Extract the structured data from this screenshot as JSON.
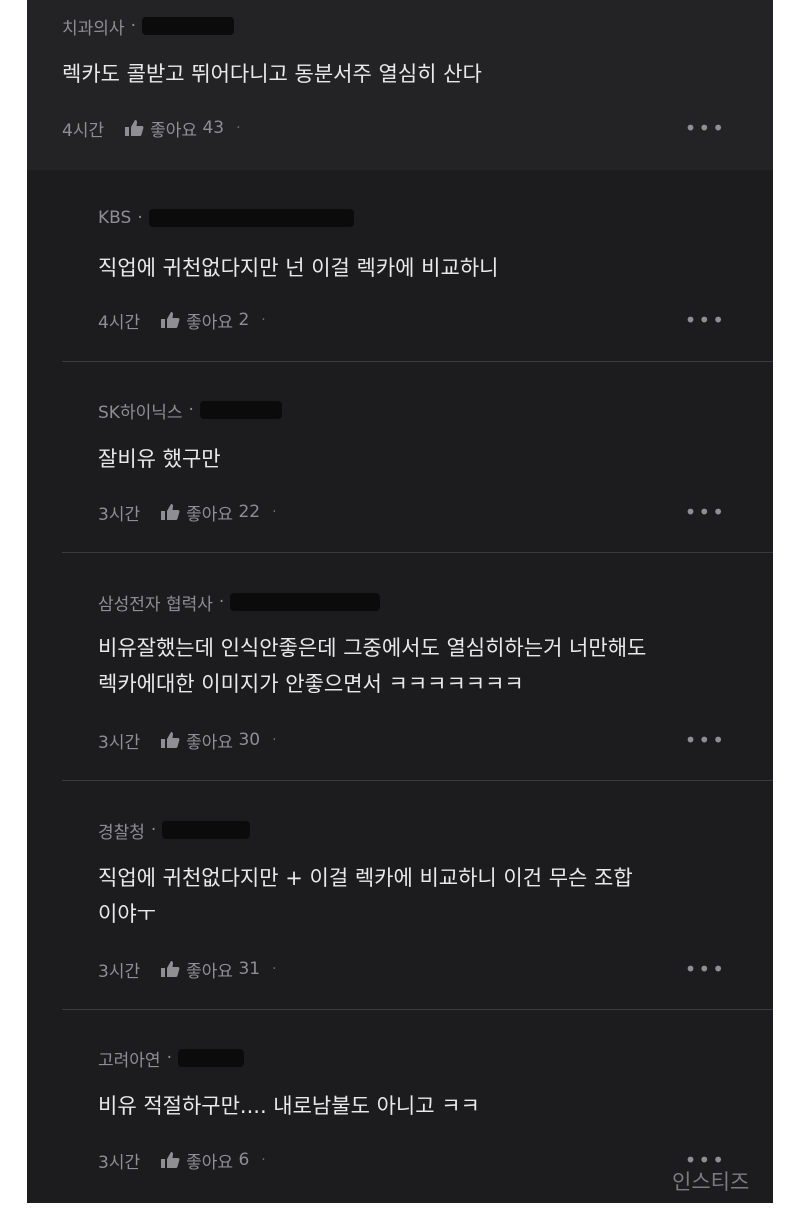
{
  "comments": [
    {
      "author": "치과의사",
      "text_lines": [
        "렉카도 콜받고 뛰어다니고 동분서주 열심히 산다"
      ],
      "time": "4시간",
      "like_label": "좋아요",
      "likes": "43"
    },
    {
      "author": "KBS",
      "text_lines": [
        "직업에 귀천없다지만 넌 이걸 렉카에 비교하니"
      ],
      "time": "4시간",
      "like_label": "좋아요",
      "likes": "2"
    },
    {
      "author": "SK하이닉스",
      "text_lines": [
        "잘비유 했구만"
      ],
      "time": "3시간",
      "like_label": "좋아요",
      "likes": "22"
    },
    {
      "author": "삼성전자 협력사",
      "text_lines": [
        "비유잘했는데 인식안좋은데 그중에서도 열심히하는거 너만해도",
        "렉카에대한 이미지가 안좋으면서 ㅋㅋㅋㅋㅋㅋㅋ"
      ],
      "time": "3시간",
      "like_label": "좋아요",
      "likes": "30"
    },
    {
      "author": "경찰청",
      "text_lines": [
        "직업에 귀천없다지만 + 이걸 렉카에 비교하니  이건 무슨 조합",
        "이야ㅜ"
      ],
      "time": "3시간",
      "like_label": "좋아요",
      "likes": "31"
    },
    {
      "author": "고려아연",
      "text_lines": [
        "비유 적절하구만.... 내로남불도 아니고 ㅋㅋ"
      ],
      "time": "3시간",
      "like_label": "좋아요",
      "likes": "6"
    }
  ],
  "icons": {
    "like": "thumbs-up-icon",
    "more": "more-horizontal-icon"
  },
  "watermark": "인스티즈",
  "colors": {
    "background": "#1c1c1e",
    "top_comment_bg": "#232325",
    "text": "#e9e9eb",
    "meta": "#8e8e93"
  }
}
